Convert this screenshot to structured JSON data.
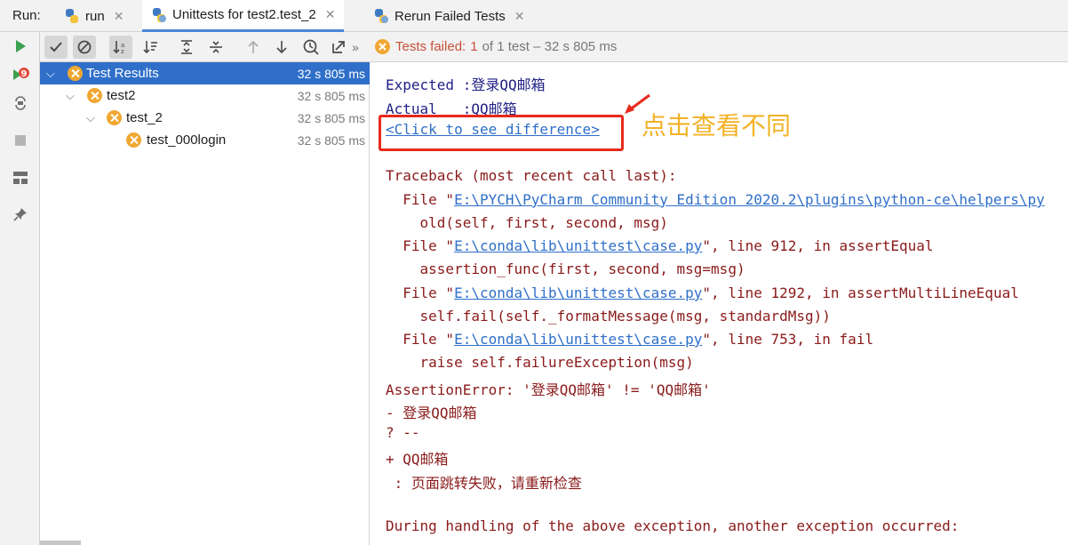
{
  "tabbar": {
    "run_label": "Run:",
    "tabs": [
      {
        "label": "run",
        "icon": "python-icon",
        "active": false
      },
      {
        "label": "Unittests for test2.test_2",
        "icon": "python-test-icon",
        "active": true
      },
      {
        "label": "Rerun Failed Tests",
        "icon": "python-test-icon",
        "active": false
      }
    ]
  },
  "left_toolbar": [
    "run-icon",
    "rerun-failed-icon",
    "toggle-auto-test-icon",
    "stop-icon",
    "layout-icon",
    "pin-icon"
  ],
  "rerun_badge": "9",
  "top_toolbar": {
    "buttons": [
      "show-passed-icon",
      "show-ignored-icon",
      "sort-alpha-icon",
      "sort-duration-icon",
      "expand-all-icon",
      "collapse-all-icon",
      "prev-failed-icon",
      "next-failed-icon",
      "history-icon",
      "export-icon",
      "more-icon"
    ],
    "status_failed": "Tests failed:",
    "status_count": "1",
    "status_rest": "of 1 test – 32 s 805 ms"
  },
  "tree": {
    "rows": [
      {
        "name": "Test Results",
        "time": "32 s 805 ms",
        "level": 0,
        "expandable": true,
        "selected": true
      },
      {
        "name": "test2",
        "time": "32 s 805 ms",
        "level": 1,
        "expandable": true,
        "selected": false
      },
      {
        "name": "test_2",
        "time": "32 s 805 ms",
        "level": 2,
        "expandable": true,
        "selected": false
      },
      {
        "name": "test_000login",
        "time": "32 s 805 ms",
        "level": 3,
        "expandable": false,
        "selected": false
      }
    ]
  },
  "console": {
    "expected_label": "Expected :",
    "expected_value": "登录QQ邮箱",
    "actual_label": "Actual   :",
    "actual_value": "QQ邮箱",
    "diff_link": "<Click to see difference>",
    "annotation": "点击查看不同",
    "traceback_header": "Traceback (most recent call last):",
    "frames": [
      {
        "pre": "  File \"",
        "path": "E:\\PYCH\\PyCharm Community Edition 2020.2\\plugins\\python-ce\\helpers\\py",
        "post": "",
        "code": "    old(self, first, second, msg)"
      },
      {
        "pre": "  File \"",
        "path": "E:\\conda\\lib\\unittest\\case.py",
        "post": "\", line 912, in assertEqual",
        "code": "    assertion_func(first, second, msg=msg)"
      },
      {
        "pre": "  File \"",
        "path": "E:\\conda\\lib\\unittest\\case.py",
        "post": "\", line 1292, in assertMultiLineEqual",
        "code": "    self.fail(self._formatMessage(msg, standardMsg))"
      },
      {
        "pre": "  File \"",
        "path": "E:\\conda\\lib\\unittest\\case.py",
        "post": "\", line 753, in fail",
        "code": "    raise self.failureException(msg)"
      }
    ],
    "assertion_error": "AssertionError: '登录QQ邮箱' != 'QQ邮箱'",
    "diff_minus": "- 登录QQ邮箱",
    "diff_marker": "? --",
    "diff_plus": "+ QQ邮箱",
    "message": " : 页面跳转失败，请重新检查",
    "during_handling": "During handling of the above exception, another exception occurred:"
  },
  "colors": {
    "accent": "#2f6fc9",
    "fail_icon": "#f0a732",
    "error_text": "#8a1a1a",
    "highlight_box": "#e8291c",
    "annotation": "#f2b224"
  }
}
